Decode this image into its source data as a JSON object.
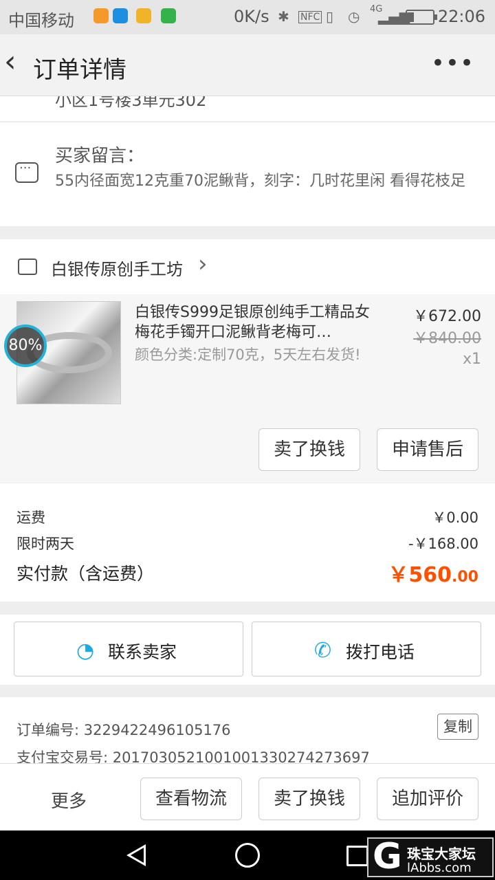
{
  "status_bar": {
    "carrier": "中国移动",
    "speed": "0K/s",
    "nfc": "NFC",
    "network": "4G",
    "time": "22:06"
  },
  "nav": {
    "title": "订单详情",
    "more": "•••"
  },
  "address_fragment": "小区1号楼3单元302",
  "memo": {
    "label": "买家留言：",
    "text": "55内径面宽12克重70泥鳅背，刻字：几时花里闲 看得花枝足"
  },
  "shop": {
    "name": "白银传原创手工坊"
  },
  "product": {
    "name": "白银传S999足银原创纯手工精品女梅花手镯开口泥鳅背老梅可…",
    "spec": "颜色分类:定制70克，5天左右发货!",
    "price": "￥672.00",
    "original_price": "￥840.00",
    "quantity": "x1",
    "badge": "80%",
    "sell_button": "卖了换钱",
    "aftersale_button": "申请售后"
  },
  "summary": {
    "shipping_label": "运费",
    "shipping_value": "￥0.00",
    "discount_label": "限时两天",
    "discount_value": "-￥168.00",
    "total_label": "实付款（含运费）",
    "total_int": "￥560",
    "total_dec": ".00",
    "total_color": "#ff5000"
  },
  "contact": {
    "seller_label": "联系卖家",
    "call_label": "拨打电话"
  },
  "order_info": {
    "order_no": "订单编号: 3229422496105176",
    "alipay_no": "支付宝交易号: 2017030521001001330274273697",
    "copy_label": "复制"
  },
  "bottom_bar": {
    "more": "更多",
    "logistics": "查看物流",
    "sell": "卖了换钱",
    "review": "追加评价"
  },
  "watermark": {
    "letter": "G",
    "name": "珠宝大家坛",
    "url": "lAbbs.com"
  }
}
